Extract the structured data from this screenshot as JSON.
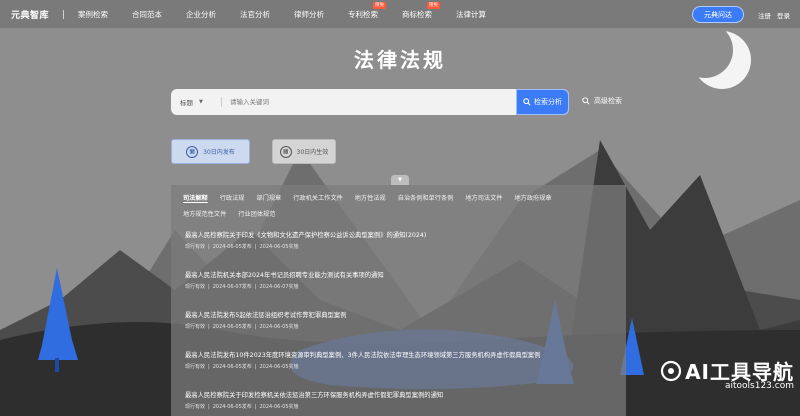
{
  "header": {
    "logo": "元典智库",
    "nav": [
      {
        "label": "案例检索",
        "badge": ""
      },
      {
        "label": "合同范本",
        "badge": ""
      },
      {
        "label": "企业分析",
        "badge": ""
      },
      {
        "label": "法官分析",
        "badge": ""
      },
      {
        "label": "律师分析",
        "badge": ""
      },
      {
        "label": "专利检索",
        "badge": "限免"
      },
      {
        "label": "商标检索",
        "badge": "限免"
      },
      {
        "label": "法律计算",
        "badge": ""
      }
    ],
    "ask_button": "元典问达",
    "register": "注册",
    "login": "登录"
  },
  "page_title": "法律法规",
  "search": {
    "scope": "标题",
    "placeholder": "请输入关键词",
    "button": "检索分析",
    "advanced": "高级检索"
  },
  "filters": {
    "last30_published": "30日内发布",
    "last30_effective": "30日内生效"
  },
  "tabs": [
    "司法解释",
    "行政法规",
    "部门规章",
    "行政机关工作文件",
    "地方性法规",
    "自治条例和单行条例",
    "地方司法文件",
    "地方政府规章",
    "地方规范性文件",
    "行业团体规范"
  ],
  "documents": [
    {
      "title": "最高人民检察院关于印发《文物和文化遗产保护检察公益诉讼典型案例》的通知(2024)",
      "status": "现行有效",
      "published": "2024-06-05发布",
      "effective": "2024-06-05实施"
    },
    {
      "title": "最高人民法院机关本部2024年书记员招聘专业能力测试有关事项的通知",
      "status": "现行有效",
      "published": "2024-06-07发布",
      "effective": "2024-06-07实施"
    },
    {
      "title": "最高人民法院发布5起依法惩治组织考试作弊犯罪典型案例",
      "status": "现行有效",
      "published": "2024-06-05发布",
      "effective": "2024-06-05实施"
    },
    {
      "title": "最高人民法院发布10件2023年度环境资源审判典型案例、3件人民法院依法审理生态环境领域第三方服务机构弄虚作假典型案例",
      "status": "现行有效",
      "published": "2024-06-05发布",
      "effective": "2024-06-05实施"
    },
    {
      "title": "最高人民检察院关于印发检察机关依法惩治第三方环保服务机构弄虚作假犯罪典型案例的通知",
      "status": "现行有效",
      "published": "2024-06-05发布",
      "effective": "2024-06-05实施"
    }
  ],
  "watermark": {
    "title": "AI工具导航",
    "url": "aitools123.com"
  },
  "colors": {
    "accent": "#3b7cf6",
    "badge": "#ff5a3c",
    "mountain_dark": "#3a3a3a",
    "tree_blue": "#2f6de0"
  }
}
